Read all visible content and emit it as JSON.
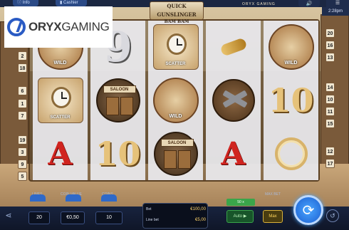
{
  "brand": {
    "logo_prefix": "ORYX",
    "logo_suffix": "GAMING"
  },
  "topbar": {
    "info_label": "Info",
    "cashier_label": "Cashier",
    "time": "2:28pm"
  },
  "title": {
    "line1": "QUICK GUNSLINGER",
    "line2": "BAM BAM",
    "caption": "ORYX GAMING"
  },
  "paylines": {
    "left": [
      "2",
      "18",
      "6",
      "1",
      "7",
      "19",
      "3",
      "9",
      "5"
    ],
    "right": [
      "20",
      "16",
      "13",
      "14",
      "10",
      "11",
      "15",
      "12",
      "17"
    ]
  },
  "reels": [
    [
      "wild-sheriff",
      "scatter-watch",
      "dynamite"
    ],
    [
      "nine",
      "saloon",
      "ten"
    ],
    [
      "scatter-watch",
      "wild-sheriff",
      "saloon"
    ],
    [
      "bullet",
      "guns",
      "dynamite"
    ],
    [
      "wild-sheriff",
      "ten",
      "lasso"
    ]
  ],
  "symbol_text": {
    "wild": "WILD",
    "scatter": "SCATTER",
    "saloon": "SALOON",
    "nine": "9",
    "ten": "10",
    "dynamite": "A"
  },
  "controls": {
    "lines_label": "Lines",
    "lines_value": "20",
    "coin_label": "Coin value",
    "coin_value": "€0,50",
    "coins_label": "Coins",
    "coins_value": "10",
    "bet_label": "Bet",
    "bet_value": "€100,00",
    "linebet_label": "Line bet",
    "linebet_value": "€5,00",
    "auto_count": "50 x",
    "auto_label": "Auto",
    "max_label": "Max",
    "maxbet_label": "Max bet"
  },
  "icons": [
    "info-icon",
    "cashier-icon",
    "sound-icon",
    "menu-icon",
    "share-icon",
    "spin-icon",
    "history-icon"
  ]
}
